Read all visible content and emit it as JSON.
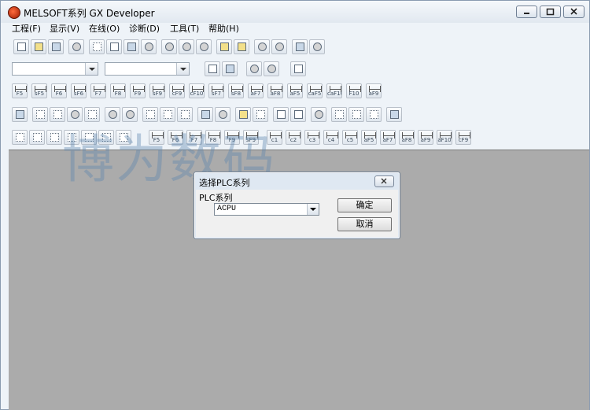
{
  "window": {
    "title": "MELSOFT系列 GX Developer",
    "minimize_label": "▁",
    "maximize_label": "▢",
    "close_label": "✕"
  },
  "menu": [
    {
      "label": "工程(F)"
    },
    {
      "label": "显示(V)"
    },
    {
      "label": "在线(O)"
    },
    {
      "label": "诊断(D)"
    },
    {
      "label": "工具(T)"
    },
    {
      "label": "帮助(H)"
    }
  ],
  "toolbars": {
    "ladder_labels": [
      "F5",
      "sF5",
      "F6",
      "sF6",
      "F7",
      "F8",
      "F9",
      "sF9",
      "cF9",
      "cF10",
      "sF7",
      "sF8",
      "aF7",
      "aF8",
      "aF5",
      "caF5",
      "caF10",
      "F10",
      "aF9"
    ],
    "device_labels": [
      "F5",
      "F6",
      "F7",
      "F8",
      "F9",
      "sF9",
      "c1",
      "c2",
      "c3",
      "c4",
      "c5",
      "aF5",
      "aF7",
      "aF8",
      "aF9",
      "aF10",
      "cF9"
    ]
  },
  "watermark": "博为数码",
  "dialog": {
    "title": "选择PLC系列",
    "close_label": "✕",
    "field_label": "PLC系列",
    "selected_value": "ACPU",
    "ok_label": "确定",
    "cancel_label": "取消"
  }
}
